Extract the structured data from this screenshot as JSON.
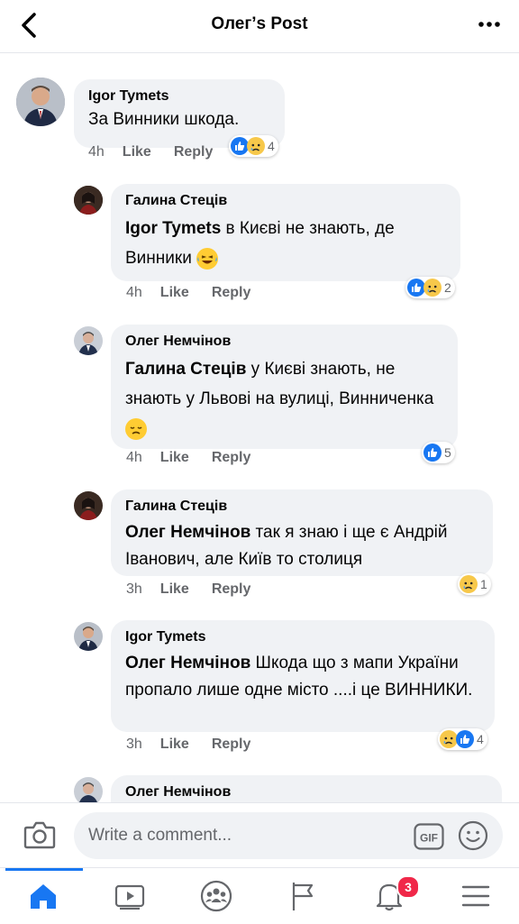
{
  "header": {
    "title": "Олег’s Post"
  },
  "colors": {
    "accent": "#1877f2",
    "bubble": "#f0f2f5",
    "meta": "#65676b",
    "badge": "#f02849"
  },
  "comments": [
    {
      "author": "Igor Tymets",
      "text": "За Винники шкода.",
      "time": "4h",
      "like": "Like",
      "reply": "Reply",
      "reaction_count": "4",
      "reaction_icons": [
        "like-icon",
        "sad-icon"
      ]
    },
    {
      "author": "Галина Стеців",
      "mention": "Igor Tymets",
      "text": " в Києві не знають, де Винники",
      "emoji": "laughing-emoji",
      "time": "4h",
      "like": "Like",
      "reply": "Reply",
      "reaction_count": "2",
      "reaction_icons": [
        "like-icon",
        "sad-icon"
      ]
    },
    {
      "author": "Олег Немчінов",
      "mention": "Галина Стеців",
      "text": " у Києві знають, не знають у Львові на вулиці, Винниченка",
      "emoji": "disappointed-emoji",
      "time": "4h",
      "like": "Like",
      "reply": "Reply",
      "reaction_count": "5",
      "reaction_icons": [
        "like-icon"
      ]
    },
    {
      "author": "Галина Стеців",
      "mention": "Олег Немчінов",
      "text": " так я знаю і ще є Андрій Іванович, але Київ то столиця",
      "time": "3h",
      "like": "Like",
      "reply": "Reply",
      "reaction_count": "1",
      "reaction_icons": [
        "sad-icon"
      ]
    },
    {
      "author": "Igor Tymets",
      "mention": "Олег Немчінов",
      "text": " Шкода що з мапи України пропало лише одне місто ....і це ВИННИКИ.",
      "time": "3h",
      "like": "Like",
      "reply": "Reply",
      "reaction_count": "4",
      "reaction_icons": [
        "sad-icon",
        "like-icon"
      ]
    },
    {
      "author": "Олег Немчінов"
    }
  ],
  "composer": {
    "placeholder": "Write a comment...",
    "gif_label": "GIF"
  },
  "tabbar": {
    "items": [
      "home-icon",
      "watch-icon",
      "groups-icon",
      "pages-icon",
      "notifications-icon",
      "menu-icon"
    ],
    "notifications_badge": "3",
    "active": "home"
  }
}
